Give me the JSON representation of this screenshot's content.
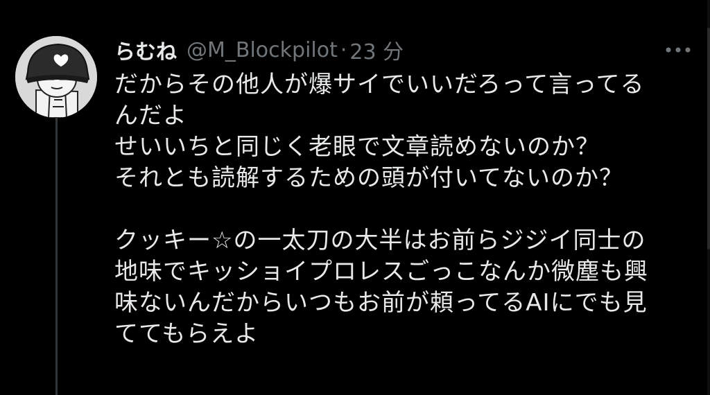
{
  "tweet": {
    "display_name": "らむね",
    "handle": "@M_Blockpilot",
    "separator": "·",
    "timestamp": "23 分",
    "avatar_icon": "helmet-character-avatar",
    "more_icon": "more-horizontal-icon",
    "lines": [
      "だからその他人が爆サイでいいだろって言ってる",
      "んだよ",
      "せいいちと同じく老眼で文章読めないのか？",
      "それとも読解するための頭が付いてないのか？",
      "",
      "クッキー☆の一太刀の大半はお前らジジイ同士の",
      "地味でキッショイプロレスごっこなんか微塵も興",
      "味ないんだからいつもお前が頼ってるAIにでも見",
      "ててもらえよ"
    ]
  },
  "colors": {
    "background": "#000000",
    "primary_text": "#e7e9ea",
    "secondary_text": "#71767b",
    "thread_line": "#333639"
  }
}
